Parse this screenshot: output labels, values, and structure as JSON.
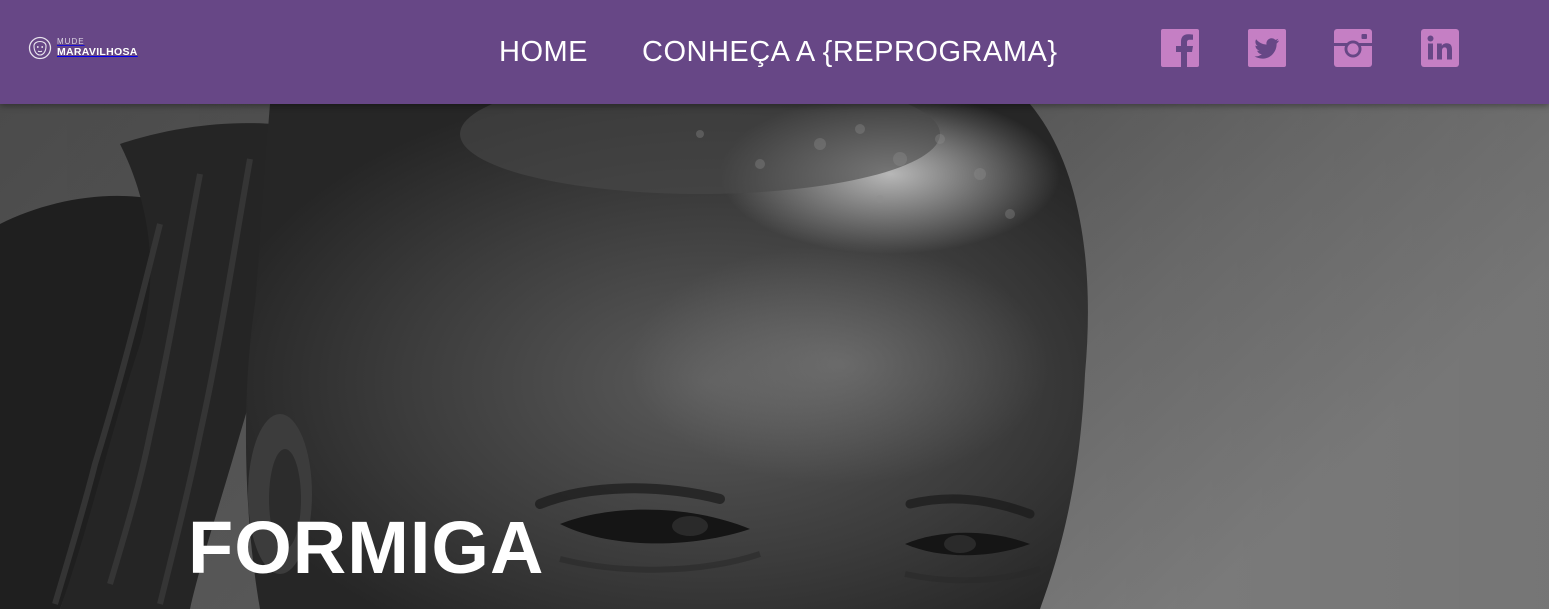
{
  "brand": {
    "line1": "MUDE",
    "line2": "MARAVILHOSA",
    "logo_icon": "woman-face-logo-icon"
  },
  "nav": {
    "items": [
      {
        "label": "HOME"
      },
      {
        "label": "CONHEÇA A {REPROGRAMA}"
      }
    ]
  },
  "social": [
    {
      "icon": "facebook-icon"
    },
    {
      "icon": "twitter-icon"
    },
    {
      "icon": "instagram-icon"
    },
    {
      "icon": "linkedin-icon"
    }
  ],
  "hero": {
    "title": "FORMIGA",
    "image": "black-and-white portrait photo"
  },
  "colors": {
    "header_bg": "#674786",
    "social_icon": "#c57fc4",
    "text": "#ffffff"
  }
}
